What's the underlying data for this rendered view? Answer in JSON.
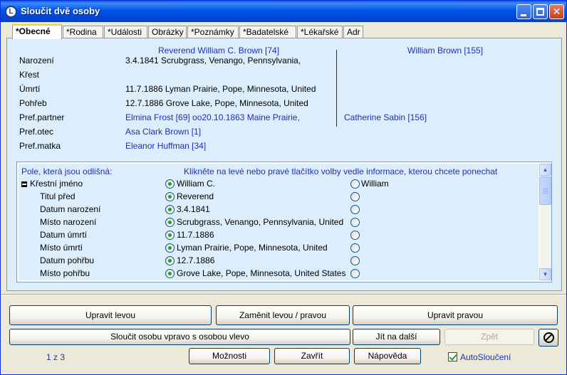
{
  "window": {
    "title": "Sloučit dvě osoby",
    "icon_letter": "L"
  },
  "tabs": [
    {
      "label": "*Obecné"
    },
    {
      "label": "*Rodina"
    },
    {
      "label": "*Události"
    },
    {
      "label": "Obrázky"
    },
    {
      "label": "*Poznámky"
    },
    {
      "label": "*Badatelské"
    },
    {
      "label": "*Lékařské"
    },
    {
      "label": "Adr"
    }
  ],
  "persons": {
    "left_header": "Reverend William C. Brown [74]",
    "right_header": "William Brown [155]"
  },
  "summary": [
    {
      "label": "Narození",
      "left": "3.4.1841 Scrubgrass, Venango, Pennsylvania,",
      "right": ""
    },
    {
      "label": "Křest",
      "left": "",
      "right": ""
    },
    {
      "label": "Úmrtí",
      "left": "11.7.1886 Lyman Prairie, Pope, Minnesota, United",
      "right": ""
    },
    {
      "label": "Pohřeb",
      "left": "12.7.1886 Grove Lake, Pope, Minnesota, United",
      "right": ""
    },
    {
      "label": "Pref.partner",
      "left": "Elmina Frost [69] oo20.10.1863 Maine Prairie,",
      "right": "Catherine Sabin [156]"
    },
    {
      "label": "Pref.otec",
      "left": "Asa Clark Brown [1]",
      "right": ""
    },
    {
      "label": "Pref.matka",
      "left": "Eleanor Huffman [34]",
      "right": ""
    }
  ],
  "differences": {
    "title_left": "Pole, která jsou odlišná:",
    "title_right": "Klikněte na levé nebo pravé tlačítko volby vedle informace, kterou chcete ponechat",
    "rows": [
      {
        "label": "Křestní jméno",
        "left": "William C.",
        "right": "William",
        "selected": "left"
      },
      {
        "label": "Titul před",
        "left": "Reverend",
        "right": "",
        "selected": "left"
      },
      {
        "label": "Datum narození",
        "left": "3.4.1841",
        "right": "",
        "selected": "left"
      },
      {
        "label": "Místo narození",
        "left": "Scrubgrass, Venango, Pennsylvania, United",
        "right": "",
        "selected": "left"
      },
      {
        "label": "Datum úmrtí",
        "left": "11.7.1886",
        "right": "",
        "selected": "left"
      },
      {
        "label": "Místo úmrtí",
        "left": "Lyman Prairie, Pope, Minnesota, United",
        "right": "",
        "selected": "left"
      },
      {
        "label": "Datum pohřbu",
        "left": "12.7.1886",
        "right": "",
        "selected": "left"
      },
      {
        "label": "Místo pohřbu",
        "left": "Grove Lake, Pope, Minnesota, United States",
        "right": "",
        "selected": "left"
      }
    ]
  },
  "buttons": {
    "edit_left": "Upravit levou",
    "swap": "Zaměnit levou / pravou",
    "edit_right": "Upravit pravou",
    "merge": "Sloučit osobu vpravo s osobou vlevo",
    "next": "Jít na další",
    "back": "Zpět",
    "options": "Možnosti",
    "close": "Zavřít",
    "help": "Nápověda"
  },
  "footer": {
    "page_indicator": "1 z 3",
    "auto_merge_label": "AutoSloučení",
    "auto_merge_checked": true
  }
}
